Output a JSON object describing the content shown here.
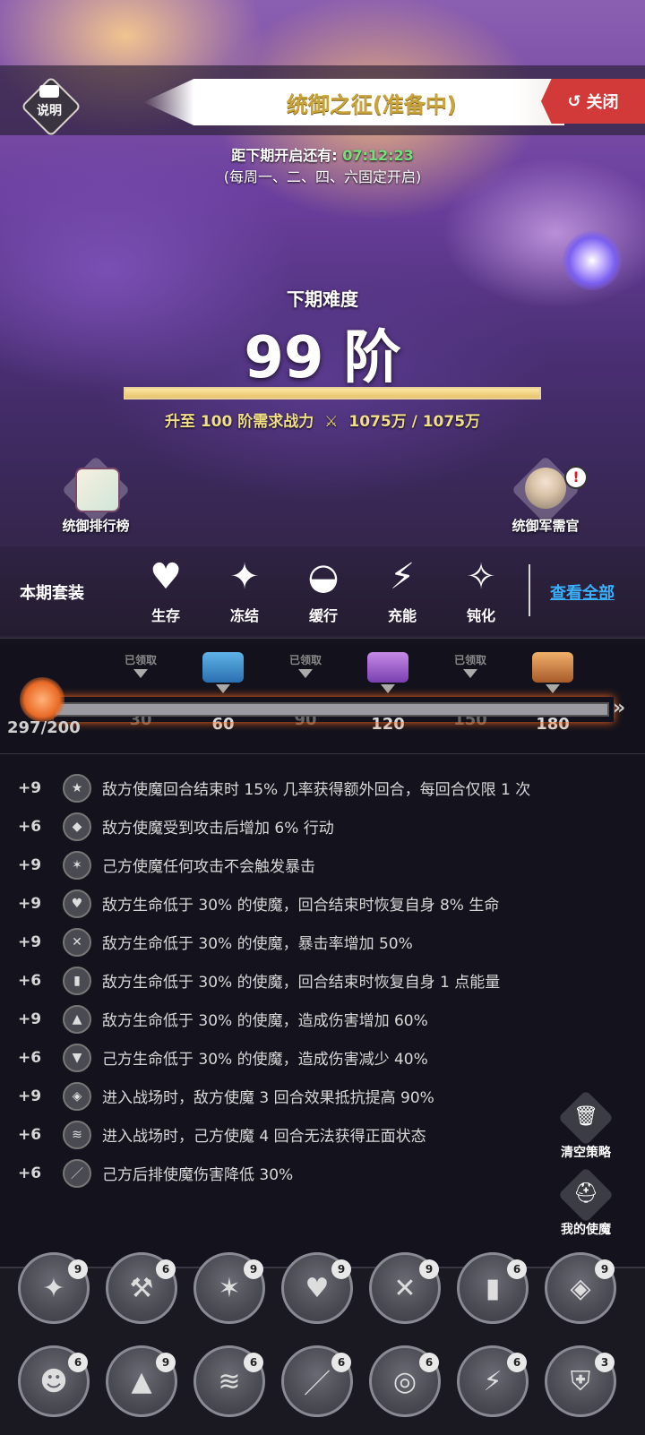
{
  "header": {
    "info_label": "说明",
    "title": "统御之征(准备中)",
    "close_label": "关闭",
    "countdown_prefix": "距下期开启还有:",
    "countdown_time": "07:12:23",
    "schedule": "(每周一、二、四、六固定开启)"
  },
  "difficulty": {
    "label": "下期难度",
    "value": "99 阶",
    "power_fill": 1.0,
    "power_prefix": "升至 100 阶需求战力",
    "power_value": "1075万 / 1075万"
  },
  "side": {
    "ranking_label": "统御排行榜",
    "officer_label": "统御军需官",
    "officer_alert": "!"
  },
  "set": {
    "label": "本期套装",
    "items": [
      {
        "name": "生存",
        "icon": "heart-plus-icon"
      },
      {
        "name": "冻结",
        "icon": "ice-shard-icon"
      },
      {
        "name": "缓行",
        "icon": "boot-icon"
      },
      {
        "name": "充能",
        "icon": "lightning-icon"
      },
      {
        "name": "钝化",
        "icon": "broken-star-icon"
      }
    ],
    "view_all": "查看全部"
  },
  "progress": {
    "score": "297/200",
    "claimed_label": "已领取",
    "milestones": [
      {
        "value": "30",
        "state": "claimed"
      },
      {
        "value": "60",
        "state": "chest-blue"
      },
      {
        "value": "90",
        "state": "claimed"
      },
      {
        "value": "120",
        "state": "chest-purple"
      },
      {
        "value": "150",
        "state": "claimed"
      },
      {
        "value": "180",
        "state": "chest-orange"
      }
    ],
    "end_arrow": "»"
  },
  "buffs": [
    {
      "level": "+9",
      "text": "敌方使魔回合结束时 15% 几率获得额外回合，每回合仅限 1 次"
    },
    {
      "level": "+6",
      "text": "敌方使魔受到攻击后增加 6% 行动"
    },
    {
      "level": "+9",
      "text": "己方使魔任何攻击不会触发暴击"
    },
    {
      "level": "+9",
      "text": "敌方生命低于 30% 的使魔，回合结束时恢复自身 8% 生命"
    },
    {
      "level": "+9",
      "text": "敌方生命低于 30% 的使魔，暴击率增加 50%"
    },
    {
      "level": "+6",
      "text": "敌方生命低于 30% 的使魔，回合结束时恢复自身 1 点能量"
    },
    {
      "level": "+9",
      "text": "敌方生命低于 30% 的使魔，造成伤害增加 60%"
    },
    {
      "level": "+6",
      "text": "己方生命低于 30% 的使魔，造成伤害减少 40%"
    },
    {
      "level": "+9",
      "text": "进入战场时，敌方使魔 3 回合效果抵抗提高 90%"
    },
    {
      "level": "+6",
      "text": "进入战场时，己方使魔 4 回合无法获得正面状态"
    },
    {
      "level": "+6",
      "text": "己方后排使魔伤害降低 30%"
    }
  ],
  "actions": {
    "clear_label": "清空策略",
    "my_pets_label": "我的使魔"
  },
  "grid": [
    {
      "badge": "9",
      "icon": "sparkle-icon"
    },
    {
      "badge": "6",
      "icon": "hammer-icon"
    },
    {
      "badge": "9",
      "icon": "shatter-icon"
    },
    {
      "badge": "9",
      "icon": "cat-heart-icon"
    },
    {
      "badge": "9",
      "icon": "cat-sword-icon"
    },
    {
      "badge": "6",
      "icon": "cat-battery-icon"
    },
    {
      "badge": "9",
      "icon": "cat-shield-icon"
    },
    {
      "badge": "6",
      "icon": "person-icon"
    },
    {
      "badge": "9",
      "icon": "cat-up-icon"
    },
    {
      "badge": "6",
      "icon": "person-wave-icon"
    },
    {
      "badge": "6",
      "icon": "blade-icon"
    },
    {
      "badge": "6",
      "icon": "target-icon"
    },
    {
      "badge": "6",
      "icon": "claw-icon"
    },
    {
      "badge": "3",
      "icon": "shield-bolt-icon"
    }
  ]
}
